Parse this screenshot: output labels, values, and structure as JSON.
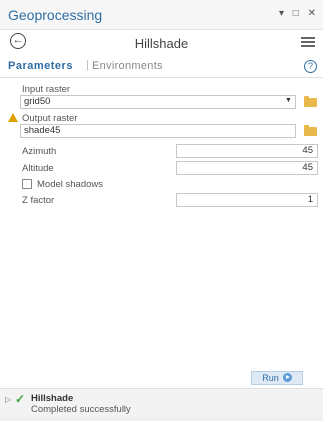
{
  "window": {
    "title": "Geoprocessing",
    "controls": "▾ □ ✕"
  },
  "tool": {
    "name": "Hillshade",
    "back_glyph": "←"
  },
  "tabs": {
    "parameters": "Parameters",
    "separator": "|",
    "environments": "Environments",
    "help_glyph": "?"
  },
  "params": {
    "input_raster": {
      "label": "Input raster",
      "value": "grid50"
    },
    "output_raster": {
      "label": "Output raster",
      "value": "shade45"
    },
    "azimuth": {
      "label": "Azimuth",
      "value": "45"
    },
    "altitude": {
      "label": "Altitude",
      "value": "45"
    },
    "model_shadows": {
      "label": "Model shadows",
      "checked": false
    },
    "z_factor": {
      "label": "Z factor",
      "value": "1"
    }
  },
  "run": {
    "label": "Run"
  },
  "status": {
    "expand_glyph": "▷",
    "check_glyph": "✓",
    "title": "Hillshade",
    "message": "Completed successfully"
  },
  "colors": {
    "accent": "#2f6ea5",
    "success": "#3ea33e",
    "warning": "#e0a000",
    "folder": "#e8b84a"
  }
}
